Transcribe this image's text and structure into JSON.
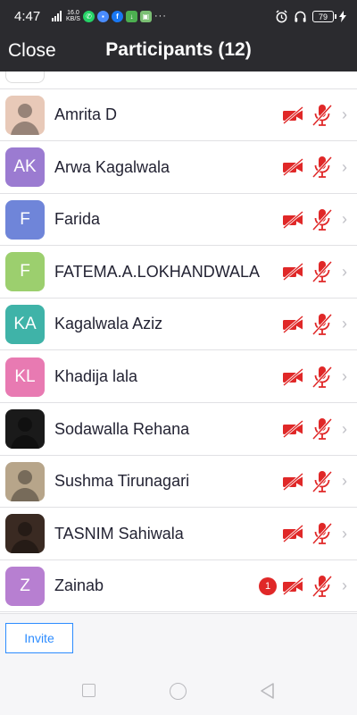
{
  "status_bar": {
    "time": "4:47",
    "net_speed": "16.0",
    "net_unit": "KB/S",
    "battery": "79",
    "icons": [
      "signal-icon",
      "whatsapp-icon",
      "messages-icon",
      "facebook-icon",
      "download-icon",
      "gallery-icon",
      "more-icon",
      "alarm-icon",
      "headphones-icon",
      "charging-icon"
    ]
  },
  "header": {
    "close_label": "Close",
    "title": "Participants (12)"
  },
  "participants": [
    {
      "name": "Amrita D",
      "initials": "",
      "avatar_color": "#e8c9b8",
      "photo": true,
      "badge": ""
    },
    {
      "name": "Arwa Kagalwala",
      "initials": "AK",
      "avatar_color": "#9b7bd1",
      "photo": false,
      "badge": ""
    },
    {
      "name": "Farida",
      "initials": "F",
      "avatar_color": "#6f85d9",
      "photo": false,
      "badge": ""
    },
    {
      "name": "FATEMA.A.LOKHANDWALA",
      "initials": "F",
      "avatar_color": "#9ccf6e",
      "photo": false,
      "badge": ""
    },
    {
      "name": "Kagalwala Aziz",
      "initials": "KA",
      "avatar_color": "#3fb3a8",
      "photo": false,
      "badge": ""
    },
    {
      "name": "Khadija lala",
      "initials": "KL",
      "avatar_color": "#e87ab2",
      "photo": false,
      "badge": ""
    },
    {
      "name": "Sodawalla Rehana",
      "initials": "",
      "avatar_color": "#1a1a1a",
      "photo": true,
      "badge": ""
    },
    {
      "name": "Sushma Tirunagari",
      "initials": "",
      "avatar_color": "#b7a58a",
      "photo": true,
      "badge": ""
    },
    {
      "name": "TASNIM Sahiwala",
      "initials": "",
      "avatar_color": "#3a2a22",
      "photo": true,
      "badge": ""
    },
    {
      "name": "Zainab",
      "initials": "Z",
      "avatar_color": "#b77fd1",
      "photo": false,
      "badge": "1"
    }
  ],
  "invite_label": "Invite",
  "colors": {
    "header_bg": "#2b2b2f",
    "muted_red": "#e02828",
    "invite_blue": "#2d8cff"
  }
}
